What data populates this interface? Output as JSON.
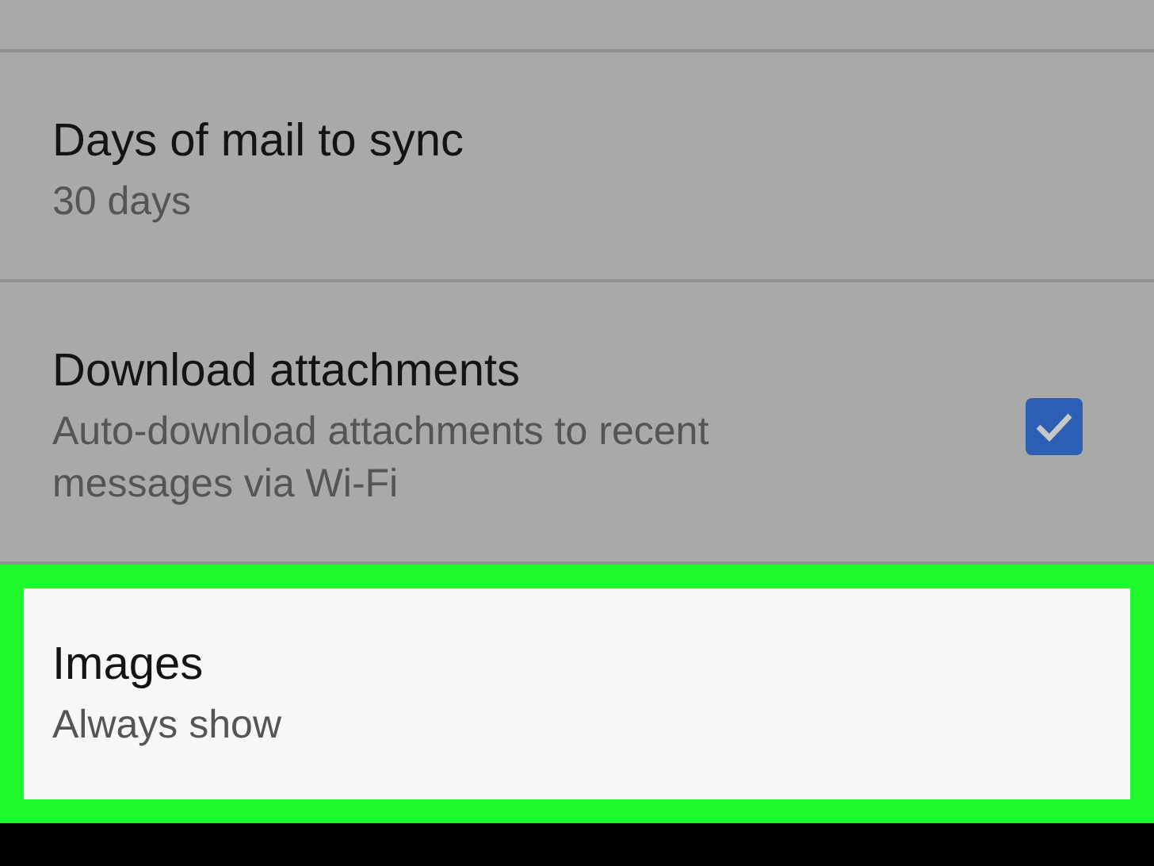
{
  "settings": [
    {
      "kind": "plain",
      "title": "Days of mail to sync",
      "summary": "30 days",
      "highlighted": false
    },
    {
      "kind": "checkbox",
      "title": "Download attachments",
      "summary": "Auto-download attachments to recent messages via Wi-Fi",
      "checked": true,
      "highlighted": false
    },
    {
      "kind": "plain",
      "title": "Images",
      "summary": "Always show",
      "highlighted": true
    }
  ]
}
